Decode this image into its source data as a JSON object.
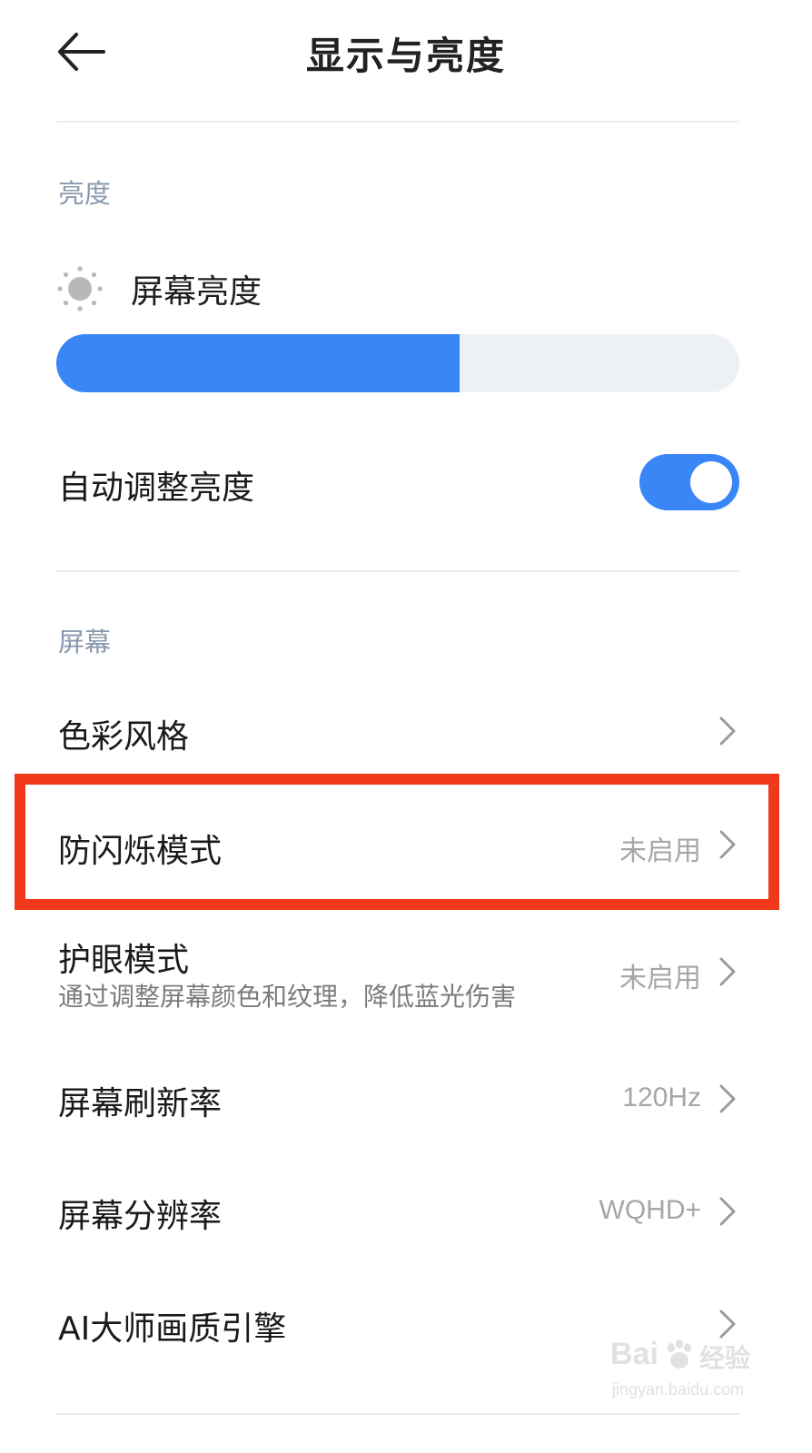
{
  "header": {
    "title": "显示与亮度",
    "back_icon": "arrow-left-icon"
  },
  "brightness_section": {
    "title": "亮度",
    "screen_brightness_label": "屏幕亮度",
    "brightness_icon": "sun-icon",
    "brightness_level_percent": 59,
    "auto_brightness_label": "自动调整亮度",
    "auto_brightness_on": true
  },
  "screen_section": {
    "title": "屏幕",
    "items": [
      {
        "label": "色彩风格",
        "value": ""
      },
      {
        "label": "防闪烁模式",
        "value": "未启用"
      },
      {
        "label": "护眼模式",
        "subtitle": "通过调整屏幕颜色和纹理，降低蓝光伤害",
        "value": "未启用"
      },
      {
        "label": "屏幕刷新率",
        "value": "120Hz"
      },
      {
        "label": "屏幕分辨率",
        "value": "WQHD+"
      },
      {
        "label": "AI大师画质引擎",
        "value": ""
      }
    ]
  },
  "watermark": {
    "brand": "Bai",
    "brand_suffix": "经验",
    "url": "jingyan.baidu.com"
  },
  "colors": {
    "accent": "#3a86f7",
    "highlight": "#f1381b",
    "section_title": "#8a98ad"
  }
}
